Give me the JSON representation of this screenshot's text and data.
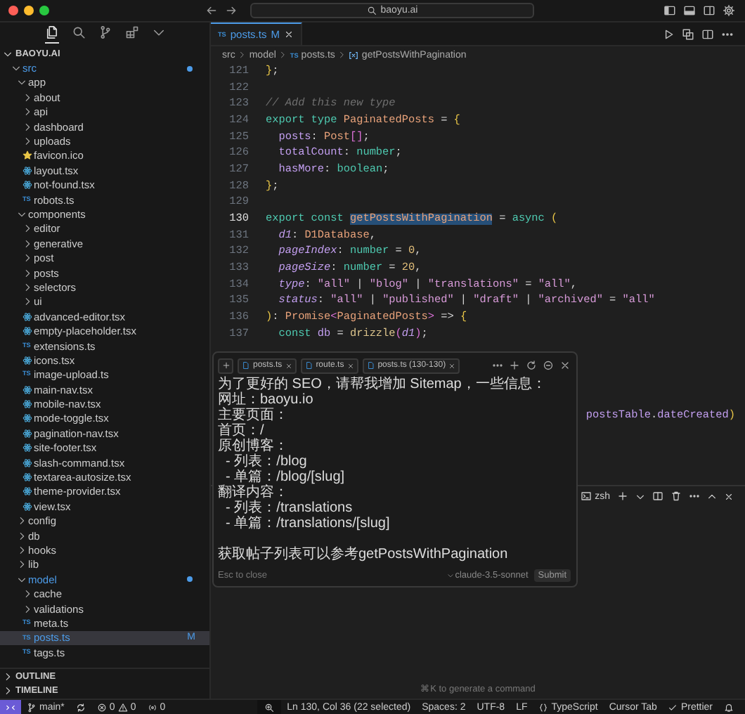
{
  "titlebar": {
    "address": "baoyu.ai"
  },
  "activity_bar": [
    {
      "kind": "explorer",
      "selected": true
    },
    {
      "kind": "search",
      "selected": false
    },
    {
      "kind": "source_control",
      "selected": false
    },
    {
      "kind": "extensions",
      "selected": false
    },
    {
      "kind": "more",
      "selected": false
    }
  ],
  "explorer": {
    "title": "BAOYU.AI",
    "expanded": true,
    "children": [
      {
        "name": "src",
        "kind": "folder",
        "expanded": true,
        "selected": false,
        "modified": true,
        "children": [
          {
            "name": "app",
            "kind": "folder",
            "expanded": true,
            "selected": false,
            "modified": false,
            "children": [
              {
                "name": "about",
                "kind": "folder",
                "expanded": false,
                "selected": false,
                "modified": false
              },
              {
                "name": "api",
                "kind": "folder",
                "expanded": false,
                "selected": false,
                "modified": false
              },
              {
                "name": "dashboard",
                "kind": "folder",
                "expanded": false,
                "selected": false,
                "modified": false
              },
              {
                "name": "uploads",
                "kind": "folder",
                "expanded": false,
                "selected": false,
                "modified": false
              },
              {
                "name": "favicon.ico",
                "kind": "ico",
                "selected": false,
                "modified": false
              },
              {
                "name": "layout.tsx",
                "kind": "tsx",
                "selected": false,
                "modified": false
              },
              {
                "name": "not-found.tsx",
                "kind": "tsx",
                "selected": false,
                "modified": false
              },
              {
                "name": "robots.ts",
                "kind": "ts",
                "icon_text": "TS",
                "selected": false,
                "modified": false
              }
            ]
          },
          {
            "name": "components",
            "kind": "folder",
            "expanded": true,
            "selected": false,
            "modified": false,
            "children": [
              {
                "name": "editor",
                "kind": "folder",
                "expanded": false,
                "selected": false,
                "modified": false
              },
              {
                "name": "generative",
                "kind": "folder",
                "expanded": false,
                "selected": false,
                "modified": false
              },
              {
                "name": "post",
                "kind": "folder",
                "expanded": false,
                "selected": false,
                "modified": false
              },
              {
                "name": "posts",
                "kind": "folder",
                "expanded": false,
                "selected": false,
                "modified": false
              },
              {
                "name": "selectors",
                "kind": "folder",
                "expanded": false,
                "selected": false,
                "modified": false
              },
              {
                "name": "ui",
                "kind": "folder",
                "expanded": false,
                "selected": false,
                "modified": false
              },
              {
                "name": "advanced-editor.tsx",
                "kind": "tsx",
                "selected": false,
                "modified": false
              },
              {
                "name": "empty-placeholder.tsx",
                "kind": "tsx",
                "selected": false,
                "modified": false
              },
              {
                "name": "extensions.ts",
                "kind": "ts",
                "icon_text": "TS",
                "selected": false,
                "modified": false
              },
              {
                "name": "icons.tsx",
                "kind": "tsx",
                "selected": false,
                "modified": false
              },
              {
                "name": "image-upload.ts",
                "kind": "ts",
                "icon_text": "TS",
                "selected": false,
                "modified": false
              },
              {
                "name": "main-nav.tsx",
                "kind": "tsx",
                "selected": false,
                "modified": false
              },
              {
                "name": "mobile-nav.tsx",
                "kind": "tsx",
                "selected": false,
                "modified": false
              },
              {
                "name": "mode-toggle.tsx",
                "kind": "tsx",
                "selected": false,
                "modified": false
              },
              {
                "name": "pagination-nav.tsx",
                "kind": "tsx",
                "selected": false,
                "modified": false
              },
              {
                "name": "site-footer.tsx",
                "kind": "tsx",
                "selected": false,
                "modified": false
              },
              {
                "name": "slash-command.tsx",
                "kind": "tsx",
                "selected": false,
                "modified": false
              },
              {
                "name": "textarea-autosize.tsx",
                "kind": "tsx",
                "selected": false,
                "modified": false
              },
              {
                "name": "theme-provider.tsx",
                "kind": "tsx",
                "selected": false,
                "modified": false
              },
              {
                "name": "view.tsx",
                "kind": "tsx",
                "selected": false,
                "modified": false
              }
            ]
          },
          {
            "name": "config",
            "kind": "folder",
            "expanded": false,
            "selected": false,
            "modified": false
          },
          {
            "name": "db",
            "kind": "folder",
            "expanded": false,
            "selected": false,
            "modified": false
          },
          {
            "name": "hooks",
            "kind": "folder",
            "expanded": false,
            "selected": false,
            "modified": false
          },
          {
            "name": "lib",
            "kind": "folder",
            "expanded": false,
            "selected": false,
            "modified": false
          },
          {
            "name": "model",
            "kind": "folder",
            "expanded": true,
            "selected": false,
            "modified": true,
            "children": [
              {
                "name": "cache",
                "kind": "folder",
                "expanded": false,
                "selected": false,
                "modified": false
              },
              {
                "name": "validations",
                "kind": "folder",
                "expanded": false,
                "selected": false,
                "modified": false
              },
              {
                "name": "meta.ts",
                "kind": "ts",
                "icon_text": "TS",
                "selected": false,
                "modified": false
              },
              {
                "name": "posts.ts",
                "kind": "ts",
                "icon_text": "TS",
                "selected": true,
                "modified": true,
                "badge": "M"
              },
              {
                "name": "tags.ts",
                "kind": "ts",
                "icon_text": "TS",
                "selected": false,
                "modified": false
              }
            ]
          }
        ]
      }
    ]
  },
  "sections": [
    {
      "title": "OUTLINE",
      "expanded": false
    },
    {
      "title": "TIMELINE",
      "expanded": false
    }
  ],
  "tabs": [
    {
      "icon_text": "TS",
      "label": "posts.ts",
      "badge": "M",
      "selected": true
    }
  ],
  "breadcrumb": [
    {
      "kind": "folder",
      "text": "src"
    },
    {
      "kind": "folder",
      "text": "model"
    },
    {
      "kind": "file",
      "icon_text": "TS",
      "text": "posts.ts"
    },
    {
      "kind": "symbol",
      "text": "getPostsWithPagination"
    }
  ],
  "editor": {
    "lines": [
      {
        "number": "121",
        "current": false,
        "tokens": [
          {
            "kind": "brace",
            "text": "}"
          },
          {
            "kind": "punct",
            "text": ";"
          }
        ]
      },
      {
        "number": "122",
        "current": false
      },
      {
        "number": "123",
        "current": false,
        "tokens": [
          {
            "kind": "comment",
            "text": "// Add this new type"
          }
        ]
      },
      {
        "number": "124",
        "current": false,
        "tokens": [
          {
            "kind": "kw",
            "text": "export type "
          },
          {
            "kind": "type",
            "text": "PaginatedPosts"
          },
          {
            "kind": "punct",
            "text": " = "
          },
          {
            "kind": "brace",
            "text": "{"
          }
        ]
      },
      {
        "number": "125",
        "current": false,
        "tokens": [
          {
            "kind": "prop",
            "text": "  posts"
          },
          {
            "kind": "punct",
            "text": ": "
          },
          {
            "kind": "type",
            "text": "Post"
          },
          {
            "kind": "bracket",
            "text": "[]"
          },
          {
            "kind": "punct",
            "text": ";"
          }
        ]
      },
      {
        "number": "126",
        "current": false,
        "tokens": [
          {
            "kind": "prop",
            "text": "  totalCount"
          },
          {
            "kind": "punct",
            "text": ": "
          },
          {
            "kind": "kw",
            "text": "number"
          },
          {
            "kind": "punct",
            "text": ";"
          }
        ]
      },
      {
        "number": "127",
        "current": false,
        "tokens": [
          {
            "kind": "prop",
            "text": "  hasMore"
          },
          {
            "kind": "punct",
            "text": ": "
          },
          {
            "kind": "kw",
            "text": "boolean"
          },
          {
            "kind": "punct",
            "text": ";"
          }
        ]
      },
      {
        "number": "128",
        "current": false,
        "tokens": [
          {
            "kind": "brace",
            "text": "}"
          },
          {
            "kind": "punct",
            "text": ";"
          }
        ]
      },
      {
        "number": "129",
        "current": false
      },
      {
        "number": "130",
        "current": true,
        "tokens": [
          {
            "kind": "kw",
            "text": "export const "
          },
          {
            "kind": "sel",
            "text": "getPostsWithPagination"
          },
          {
            "kind": "punct",
            "text": " = "
          },
          {
            "kind": "kw",
            "text": "async "
          },
          {
            "kind": "brace",
            "text": "("
          }
        ]
      },
      {
        "number": "131",
        "current": false,
        "tokens": [
          {
            "kind": "param",
            "text": "  d1"
          },
          {
            "kind": "punct",
            "text": ": "
          },
          {
            "kind": "type",
            "text": "D1Database"
          },
          {
            "kind": "punct",
            "text": ","
          }
        ]
      },
      {
        "number": "132",
        "current": false,
        "tokens": [
          {
            "kind": "param",
            "text": "  pageIndex"
          },
          {
            "kind": "punct",
            "text": ": "
          },
          {
            "kind": "kw",
            "text": "number"
          },
          {
            "kind": "punct",
            "text": " = "
          },
          {
            "kind": "num",
            "text": "0"
          },
          {
            "kind": "punct",
            "text": ","
          }
        ]
      },
      {
        "number": "133",
        "current": false,
        "tokens": [
          {
            "kind": "param",
            "text": "  pageSize"
          },
          {
            "kind": "punct",
            "text": ": "
          },
          {
            "kind": "kw",
            "text": "number"
          },
          {
            "kind": "punct",
            "text": " = "
          },
          {
            "kind": "num",
            "text": "20"
          },
          {
            "kind": "punct",
            "text": ","
          }
        ]
      },
      {
        "number": "134",
        "current": false,
        "tokens": [
          {
            "kind": "param",
            "text": "  type"
          },
          {
            "kind": "punct",
            "text": ": "
          },
          {
            "kind": "str",
            "text": "\"all\""
          },
          {
            "kind": "punct",
            "text": " | "
          },
          {
            "kind": "str",
            "text": "\"blog\""
          },
          {
            "kind": "punct",
            "text": " | "
          },
          {
            "kind": "str",
            "text": "\"translations\""
          },
          {
            "kind": "punct",
            "text": " = "
          },
          {
            "kind": "str",
            "text": "\"all\""
          },
          {
            "kind": "punct",
            "text": ","
          }
        ]
      },
      {
        "number": "135",
        "current": false,
        "tokens": [
          {
            "kind": "param",
            "text": "  status"
          },
          {
            "kind": "punct",
            "text": ": "
          },
          {
            "kind": "str",
            "text": "\"all\""
          },
          {
            "kind": "punct",
            "text": " | "
          },
          {
            "kind": "str",
            "text": "\"published\""
          },
          {
            "kind": "punct",
            "text": " | "
          },
          {
            "kind": "str",
            "text": "\"draft\""
          },
          {
            "kind": "punct",
            "text": " | "
          },
          {
            "kind": "str",
            "text": "\"archived\""
          },
          {
            "kind": "punct",
            "text": " = "
          },
          {
            "kind": "str",
            "text": "\"all\""
          }
        ]
      },
      {
        "number": "136",
        "current": false,
        "tokens": [
          {
            "kind": "brace",
            "text": ")"
          },
          {
            "kind": "punct",
            "text": ": "
          },
          {
            "kind": "type",
            "text": "Promise"
          },
          {
            "kind": "bracket",
            "text": "<"
          },
          {
            "kind": "type",
            "text": "PaginatedPosts"
          },
          {
            "kind": "bracket",
            "text": ">"
          },
          {
            "kind": "punct",
            "text": " => "
          },
          {
            "kind": "brace",
            "text": "{"
          }
        ]
      },
      {
        "number": "137",
        "current": false,
        "tokens": [
          {
            "kind": "kw",
            "text": "  const "
          },
          {
            "kind": "prop",
            "text": "db"
          },
          {
            "kind": "punct",
            "text": " = "
          },
          {
            "kind": "fn",
            "text": "drizzle"
          },
          {
            "kind": "bracket",
            "text": "("
          },
          {
            "kind": "param",
            "text": "d1"
          },
          {
            "kind": "bracket",
            "text": ")"
          },
          {
            "kind": "punct",
            "text": ";"
          }
        ]
      }
    ],
    "obscured_fragment": [
      {
        "kind": "prop",
        "text": "postsTable"
      },
      {
        "kind": "punct",
        "text": "."
      },
      {
        "kind": "prop",
        "text": "dateCreated"
      },
      {
        "kind": "brace",
        "text": ")"
      }
    ]
  },
  "chat_popup": {
    "chips": [
      {
        "label": "posts.ts"
      },
      {
        "label": "route.ts"
      },
      {
        "label": "posts.ts (130-130)"
      }
    ],
    "paragraphs": [
      [
        "为了更好的 SEO，请帮我增加 Sitemap，一些信息：",
        "网址：baoyu.io",
        "主要页面：",
        "首页：/",
        "原创博客：",
        "  - 列表：/blog",
        "  - 单篇：/blog/[slug]",
        "翻译内容：",
        "  - 列表：/translations",
        "  - 单篇：/translations/[slug]"
      ],
      [
        "获取帖子列表可以参考getPostsWithPagination"
      ]
    ],
    "hint": "Esc to close",
    "model": "claude-3.5-sonnet",
    "submit": "Submit"
  },
  "terminal": {
    "tab": "zsh",
    "hint": "⌘K to generate a command"
  },
  "status_bar": {
    "left": [
      {
        "kind": "remote"
      },
      {
        "kind": "branch",
        "text": "main*"
      },
      {
        "kind": "sync"
      },
      {
        "kind": "problems",
        "errors": "0",
        "warnings": "0"
      },
      {
        "kind": "ports",
        "text": "0"
      }
    ],
    "right": [
      {
        "kind": "zoom"
      },
      {
        "kind": "text",
        "text": "Ln 130, Col 36 (22 selected)"
      },
      {
        "kind": "text",
        "text": "Spaces: 2"
      },
      {
        "kind": "text",
        "text": "UTF-8"
      },
      {
        "kind": "text",
        "text": "LF"
      },
      {
        "kind": "language",
        "text": "TypeScript"
      },
      {
        "kind": "text",
        "text": "Cursor Tab"
      },
      {
        "kind": "formatter",
        "text": "Prettier"
      },
      {
        "kind": "bell"
      }
    ]
  }
}
